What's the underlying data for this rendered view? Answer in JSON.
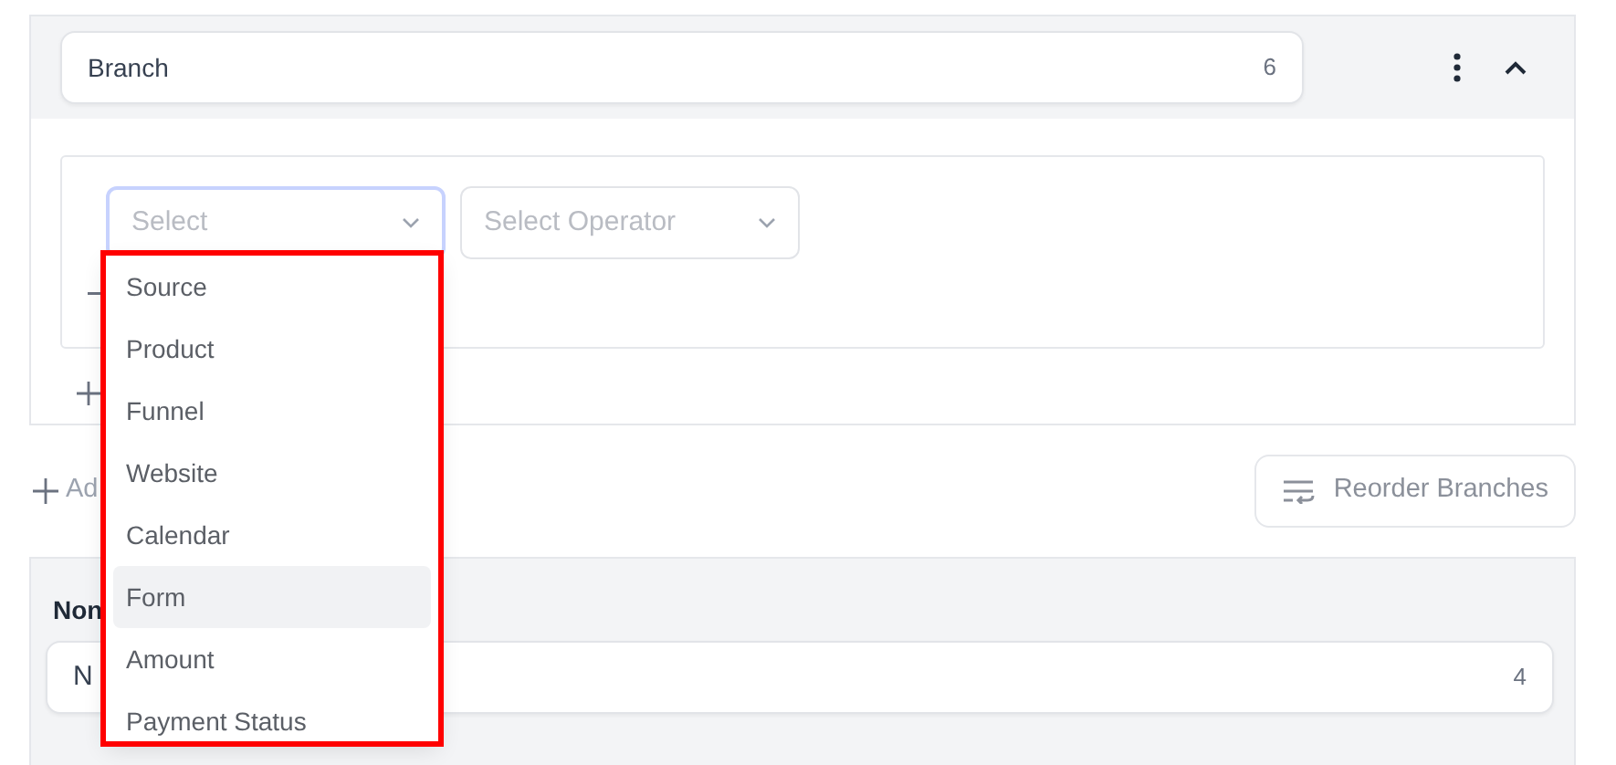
{
  "branch_card": {
    "name": "Branch",
    "count": "6",
    "expanded": true,
    "condition": {
      "field_select": {
        "placeholder": "Select",
        "focused": true
      },
      "operator_select": {
        "placeholder": "Select Operator"
      }
    }
  },
  "add_branch_link": "Ad",
  "reorder_button": "Reorder Branches",
  "second_card": {
    "heading": "Non",
    "name": "N",
    "count": "4"
  },
  "dropdown": {
    "items": [
      {
        "label": "Source",
        "selected": false
      },
      {
        "label": "Product",
        "selected": false
      },
      {
        "label": "Funnel",
        "selected": false
      },
      {
        "label": "Website",
        "selected": false
      },
      {
        "label": "Calendar",
        "selected": false
      },
      {
        "label": "Form",
        "selected": true
      },
      {
        "label": "Amount",
        "selected": false
      },
      {
        "label": "Payment Status",
        "selected": false
      }
    ]
  }
}
